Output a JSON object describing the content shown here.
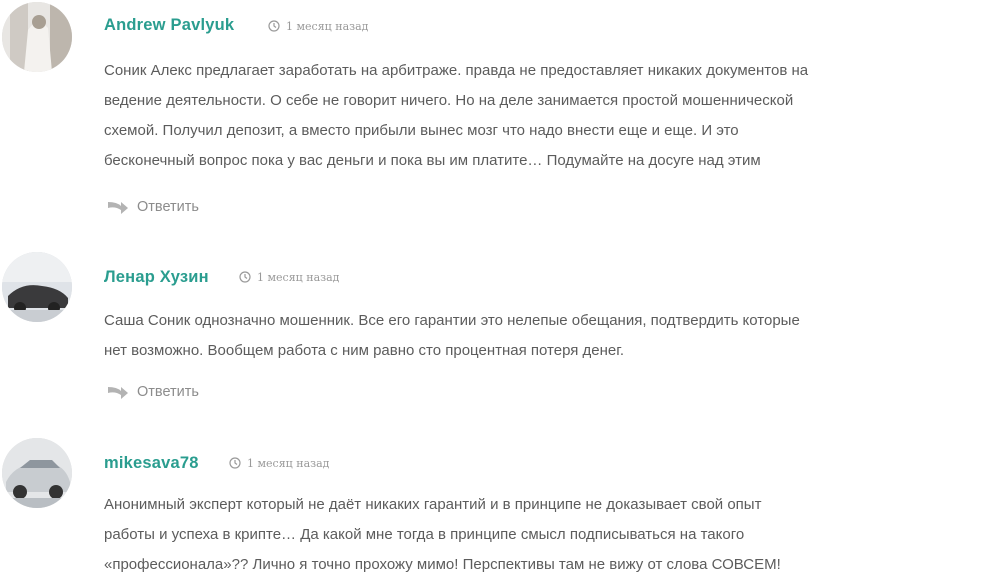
{
  "comments": [
    {
      "author": "Andrew Pavlyuk",
      "time": "1 месяц назад",
      "lines": [
        "Соник Алекс предлагает заработать на арбитраже. правда не предоставляет никаких документов на",
        "ведение деятельности. О себе не говорит ничего. Но на деле занимается простой мошеннической",
        "схемой. Получил депозит, а вместо прибыли вынес мозг что надо внести еще и еще. И это",
        "бесконечный вопрос пока у вас деньги и пока вы им платите… Подумайте на досуге над этим"
      ],
      "reply_label": "Ответить"
    },
    {
      "author": "Ленар Хузин",
      "time": "1 месяц назад",
      "lines": [
        "Саша Соник однозначно мошенник. Все его гарантии это нелепые обещания, подтвердить которые",
        "нет возможно. Вообщем работа с ним равно сто процентная потеря денег."
      ],
      "reply_label": "Ответить"
    },
    {
      "author": "mikesava78",
      "time": "1 месяц назад",
      "lines": [
        "Анонимный эксперт который не даёт никаких гарантий и в принципе не доказывает свой опыт",
        "работы и успеха в крипте… Да какой мне тогда в принципе смысл подписываться на такого",
        "«профессионала»?? Лично я точно прохожу мимо! Перспективы там не вижу от слова СОВСЕМ!"
      ],
      "reply_label": null
    }
  ],
  "colors": {
    "author": "#2a9d8f",
    "text": "#5c5c5c",
    "meta": "#9a9a9a",
    "reply": "#8c8c8c"
  },
  "icons": {
    "time": "clock-icon",
    "reply": "reply-arrow-icon"
  }
}
